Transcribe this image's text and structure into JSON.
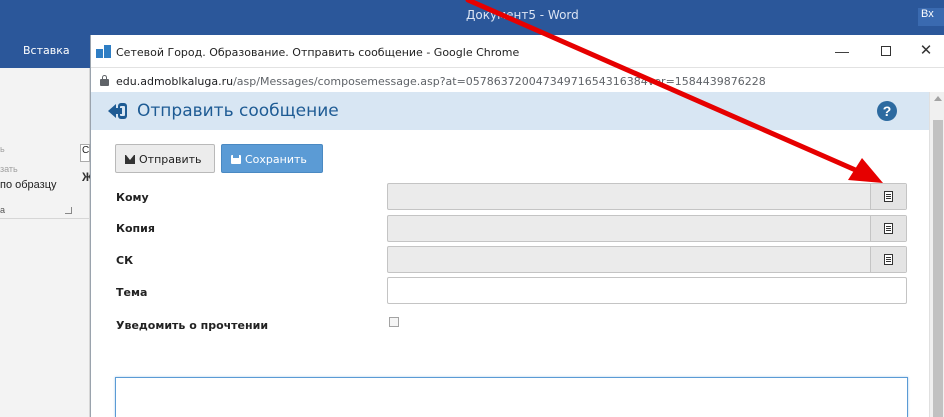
{
  "word": {
    "title": "Документ5 - Word",
    "signin_label": "Вх",
    "tab_insert": "Вставка",
    "ribbon_text_1": "ь",
    "ribbon_text_2": "зать",
    "format_painter": "по образцу",
    "ribbon_group": "а",
    "edge_box": "С",
    "edge_letter": "Ж"
  },
  "chrome": {
    "window_title": "Сетевой Город. Образование. Отправить сообщение - Google Chrome",
    "url_host": "edu.admoblkaluga.ru",
    "url_path": "/asp/Messages/composemessage.asp?at=05786372004734971654316384ver=1584439876228",
    "minimize": "—",
    "close": "✕"
  },
  "page": {
    "title": "Отправить сообщение",
    "help": "?",
    "send_button": "Отправить",
    "save_button": "Сохранить",
    "fields": {
      "to": "Кому",
      "cc": "Копия",
      "bcc": "СК",
      "subject": "Тема",
      "read_receipt": "Уведомить о прочтении"
    }
  },
  "colors": {
    "word_blue": "#2b579a",
    "header_bg": "#d8e6f3",
    "title_blue": "#1e5b94",
    "save_blue": "#5b9bd5",
    "annotation_arrow": "#e60000"
  }
}
